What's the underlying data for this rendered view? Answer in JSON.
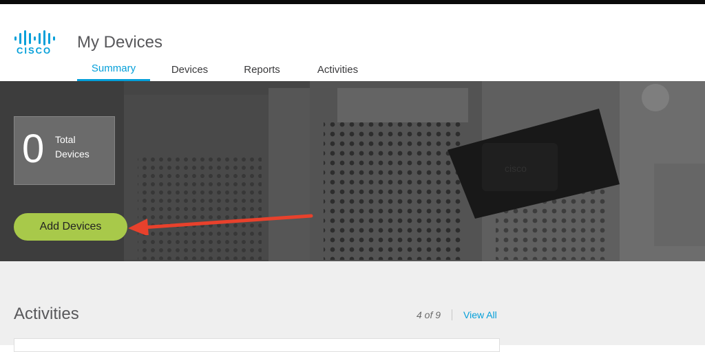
{
  "brand": {
    "logo_text": "CISCO",
    "logo_color": "#049fd9"
  },
  "header": {
    "title": "My Devices"
  },
  "tabs": [
    {
      "label": "Summary",
      "active": true
    },
    {
      "label": "Devices",
      "active": false
    },
    {
      "label": "Reports",
      "active": false
    },
    {
      "label": "Activities",
      "active": false
    }
  ],
  "hero": {
    "total_count": "0",
    "total_label": "Total Devices",
    "add_button_label": "Add Devices",
    "add_button_color": "#a8c94a",
    "annotation": "red-arrow-icon"
  },
  "activities": {
    "title": "Activities",
    "pager": "4 of 9",
    "view_all": "View All"
  },
  "colors": {
    "accent": "#049fd9",
    "arrow": "#e8412c"
  }
}
